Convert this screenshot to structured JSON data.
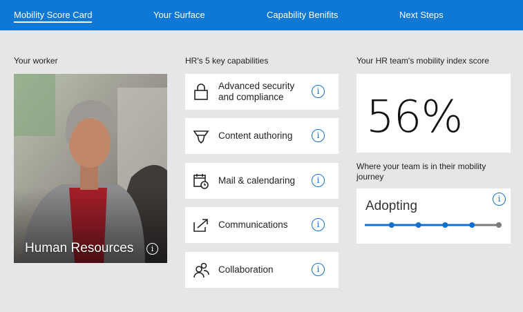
{
  "nav": {
    "tabs": [
      {
        "label": "Mobility Score Card",
        "active": true
      },
      {
        "label": "Your Surface",
        "active": false
      },
      {
        "label": "Capability Benifits",
        "active": false
      },
      {
        "label": "Next Steps",
        "active": false
      }
    ]
  },
  "worker": {
    "section_label": "Your worker",
    "department": "Human Resources",
    "info_icon": "info-icon"
  },
  "capabilities": {
    "section_label": "HR's 5 key capabilities",
    "items": [
      {
        "label": "Advanced security and compliance",
        "icon": "lock-icon"
      },
      {
        "label": "Content authoring",
        "icon": "pen-icon"
      },
      {
        "label": "Mail & calendaring",
        "icon": "calendar-clock-icon"
      },
      {
        "label": "Communications",
        "icon": "share-arrow-icon"
      },
      {
        "label": "Collaboration",
        "icon": "people-icon"
      }
    ]
  },
  "score": {
    "section_label": "Your HR team's mobility index score",
    "value": "56%"
  },
  "journey": {
    "label": "Where your team is in their mobility journey",
    "stage": "Adopting",
    "steps_total": 5,
    "steps_completed": 4
  },
  "colors": {
    "nav_bg": "#0f78d4",
    "accent": "#1170cf",
    "page_bg": "#e6e6e6",
    "inactive_track": "#7a7a7a"
  }
}
